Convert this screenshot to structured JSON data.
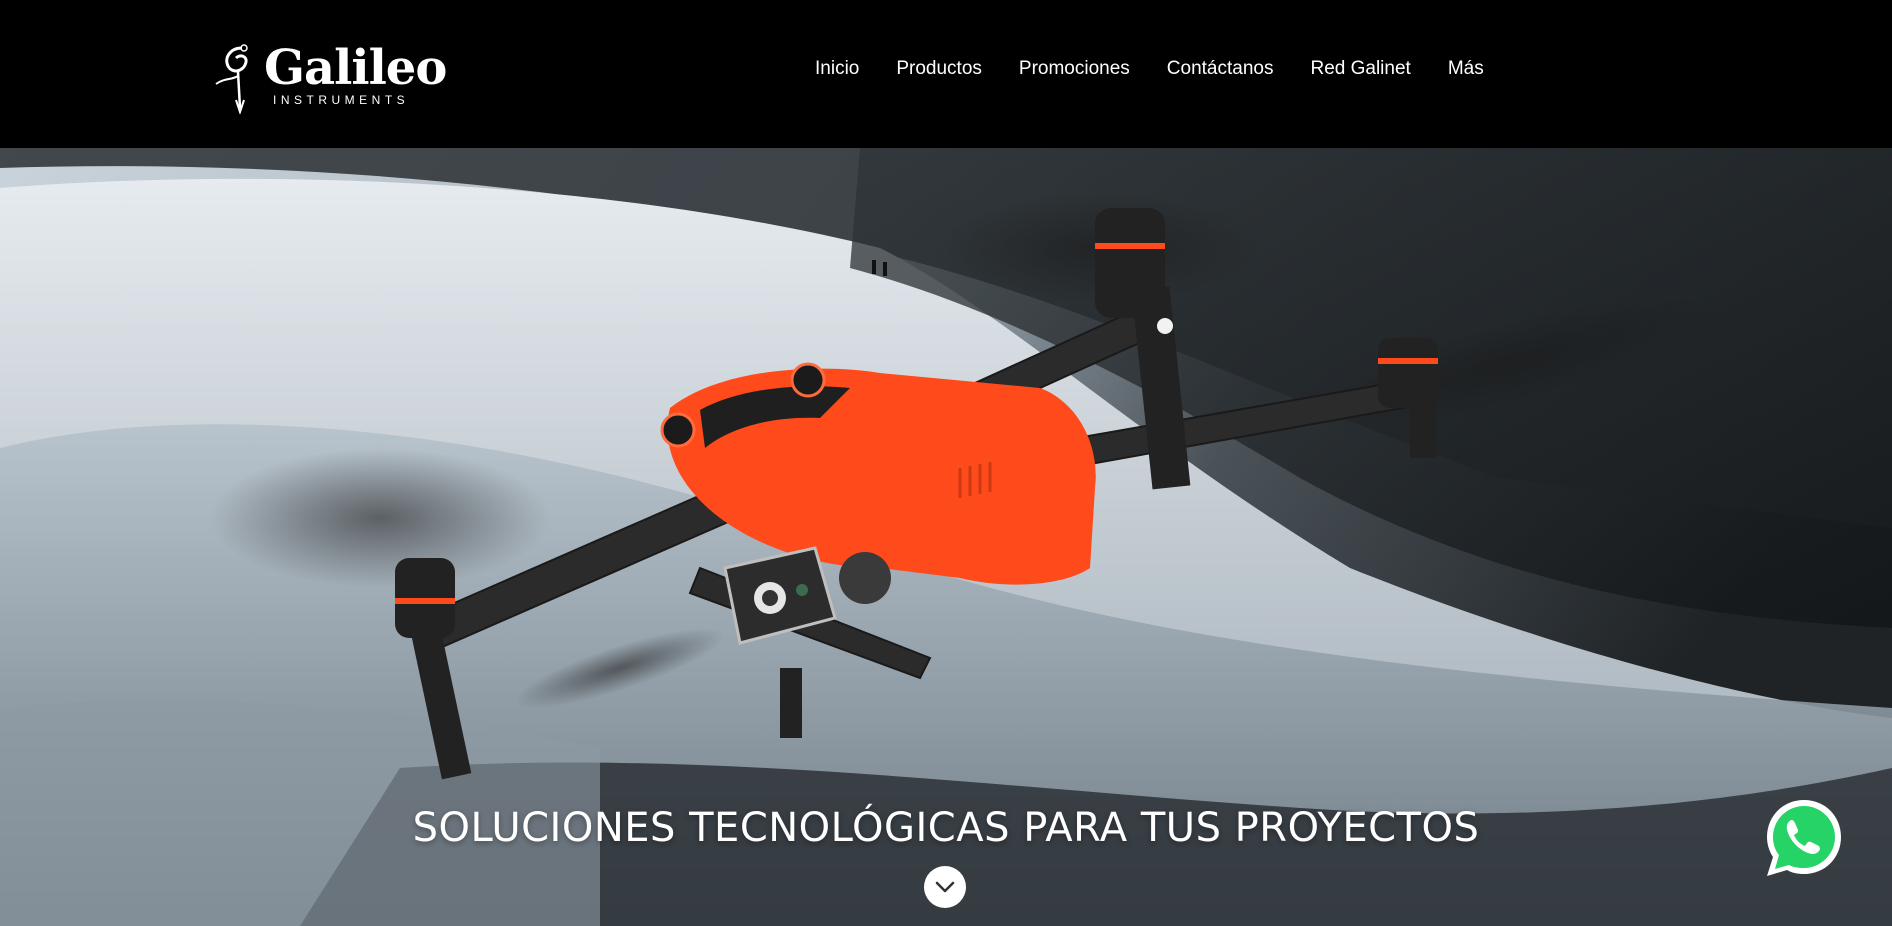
{
  "brand": {
    "name": "Galileo",
    "subtitle": "INSTRUMENTS"
  },
  "nav": {
    "items": [
      {
        "label": "Inicio"
      },
      {
        "label": "Productos"
      },
      {
        "label": "Promociones"
      },
      {
        "label": "Contáctanos"
      },
      {
        "label": "Red Galinet"
      },
      {
        "label": "Más"
      }
    ]
  },
  "hero": {
    "tagline": "SOLUCIONES TECNOLÓGICAS PARA TUS PROYECTOS",
    "scroll_icon": "chevron-down-icon"
  },
  "whatsapp": {
    "icon": "whatsapp-icon"
  },
  "colors": {
    "header_bg": "#000000",
    "drone_orange": "#ff4a1c",
    "whatsapp_green": "#25d366"
  }
}
